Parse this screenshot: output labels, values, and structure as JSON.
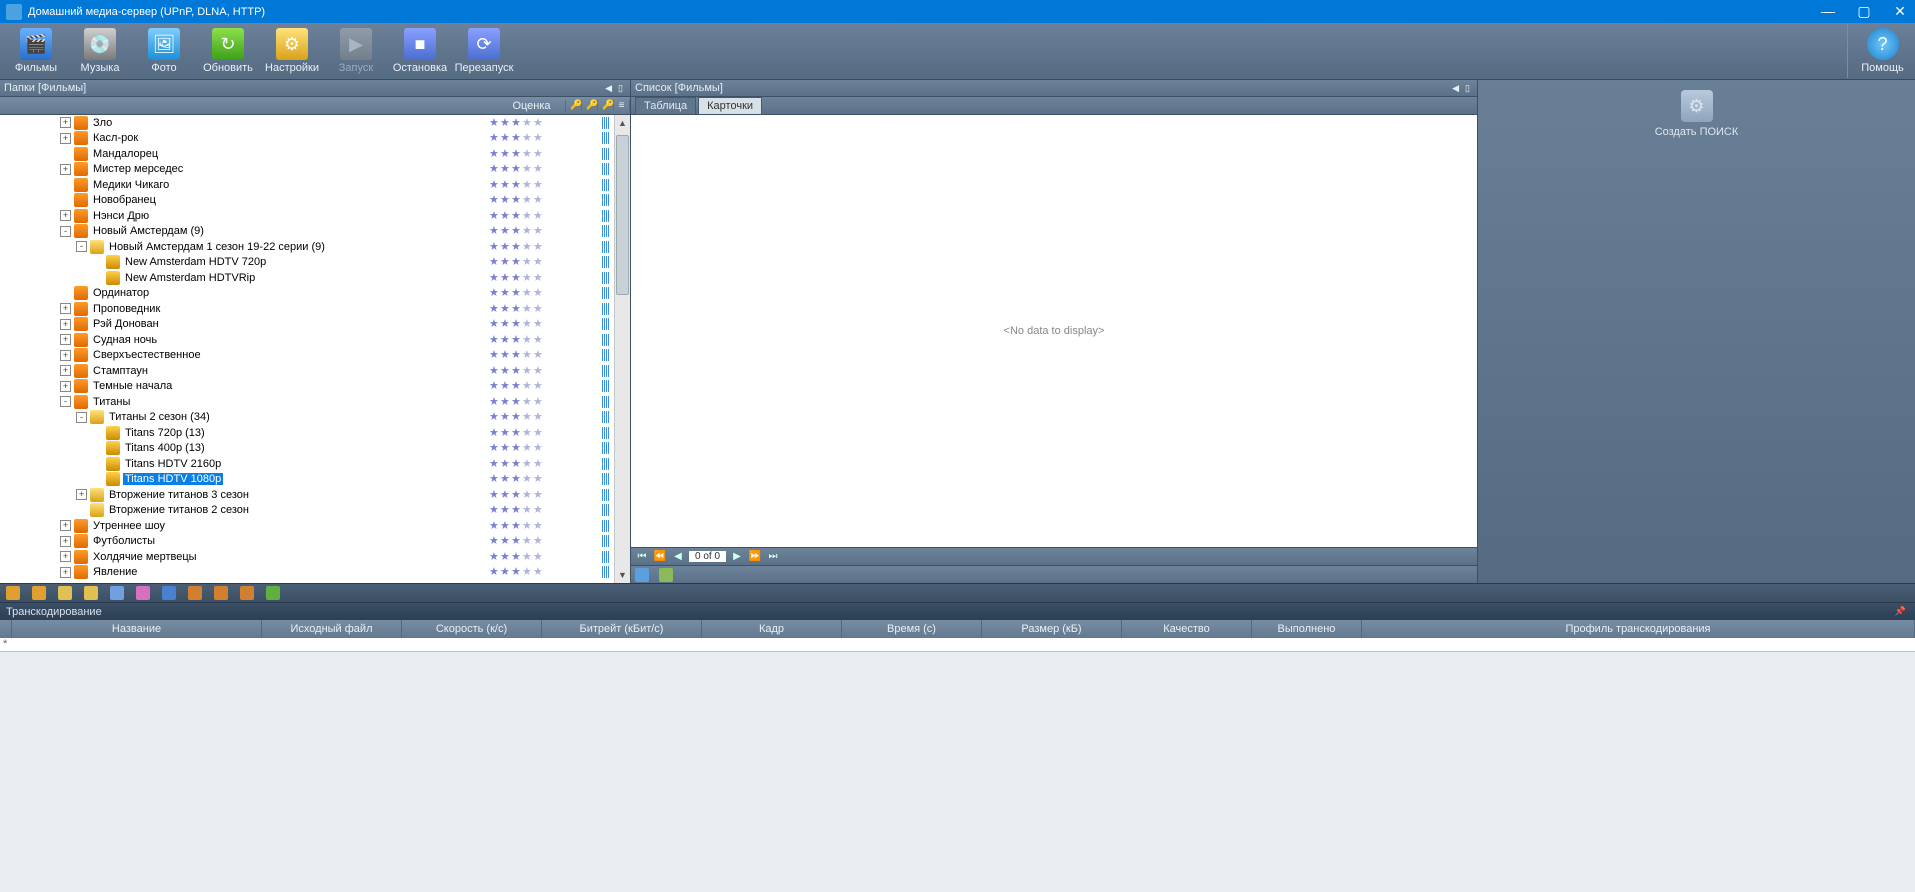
{
  "window": {
    "title": "Домашний медиа-сервер (UPnP, DLNA, HTTP)"
  },
  "toolbar": {
    "films": "Фильмы",
    "music": "Музыка",
    "photo": "Фото",
    "refresh": "Обновить",
    "settings": "Настройки",
    "start": "Запуск",
    "stop": "Остановка",
    "restart": "Перезапуск",
    "help": "Помощь"
  },
  "panels": {
    "folders_title": "Папки [Фильмы]",
    "list_title": "Список [Фильмы]",
    "rating_header": "Оценка"
  },
  "tabs": {
    "table": "Таблица",
    "cards": "Карточки"
  },
  "cards_area": {
    "no_data": "<No data to display>"
  },
  "navigator": {
    "position": "0 of 0"
  },
  "side": {
    "create": "Создать",
    "search": "ПОИСК"
  },
  "transcoding": {
    "title": "Транскодирование",
    "cols": {
      "name": "Название",
      "source": "Исходный файл",
      "speed": "Скорость (к/с)",
      "bitrate": "Битрейт (кБит/с)",
      "frame": "Кадр",
      "time": "Время (с)",
      "size": "Размер (кБ)",
      "quality": "Качество",
      "done": "Выполнено",
      "profile": "Профиль транскодирования"
    }
  },
  "tree": [
    {
      "indent": 2,
      "exp": "+",
      "icon": "rss",
      "label": "Зло",
      "rating": 3,
      "stripe": true
    },
    {
      "indent": 2,
      "exp": "+",
      "icon": "rss",
      "label": "Касл-рок",
      "rating": 3,
      "stripe": true
    },
    {
      "indent": 2,
      "exp": "",
      "icon": "rss",
      "label": "Мандалорец",
      "rating": 3,
      "stripe": true
    },
    {
      "indent": 2,
      "exp": "+",
      "icon": "rss",
      "label": "Мистер мерседес",
      "rating": 3,
      "stripe": true
    },
    {
      "indent": 2,
      "exp": "",
      "icon": "rss",
      "label": "Медики Чикаго",
      "rating": 3,
      "stripe": true
    },
    {
      "indent": 2,
      "exp": "",
      "icon": "rss",
      "label": "Новобранец",
      "rating": 3,
      "stripe": true
    },
    {
      "indent": 2,
      "exp": "+",
      "icon": "rss",
      "label": "Нэнси Дрю",
      "rating": 3,
      "stripe": true
    },
    {
      "indent": 2,
      "exp": "-",
      "icon": "rss",
      "label": "Новый Амстердам (9)",
      "rating": 3,
      "stripe": true
    },
    {
      "indent": 3,
      "exp": "-",
      "icon": "folder",
      "label": "Новый Амстердам 1 сезон 19-22 серии (9)",
      "rating": 3,
      "stripe": true
    },
    {
      "indent": 4,
      "exp": "",
      "icon": "item",
      "label": "New Amsterdam  HDTV 720p",
      "rating": 3,
      "stripe": true
    },
    {
      "indent": 4,
      "exp": "",
      "icon": "item",
      "label": "New Amsterdam  HDTVRip",
      "rating": 3,
      "stripe": true
    },
    {
      "indent": 2,
      "exp": "",
      "icon": "rss",
      "label": "Ординатор",
      "rating": 3,
      "stripe": true
    },
    {
      "indent": 2,
      "exp": "+",
      "icon": "rss",
      "label": "Проповедник",
      "rating": 3,
      "stripe": true
    },
    {
      "indent": 2,
      "exp": "+",
      "icon": "rss",
      "label": "Рэй Донован",
      "rating": 3,
      "stripe": true
    },
    {
      "indent": 2,
      "exp": "+",
      "icon": "rss",
      "label": "Судная ночь",
      "rating": 3,
      "stripe": true
    },
    {
      "indent": 2,
      "exp": "+",
      "icon": "rss",
      "label": "Сверхъестественное",
      "rating": 3,
      "stripe": true
    },
    {
      "indent": 2,
      "exp": "+",
      "icon": "rss",
      "label": "Стамптаун",
      "rating": 3,
      "stripe": true
    },
    {
      "indent": 2,
      "exp": "+",
      "icon": "rss",
      "label": "Темные начала",
      "rating": 3,
      "stripe": true
    },
    {
      "indent": 2,
      "exp": "-",
      "icon": "rss",
      "label": "Титаны",
      "rating": 3,
      "stripe": true
    },
    {
      "indent": 3,
      "exp": "-",
      "icon": "folder",
      "label": "Титаны 2 сезон (34)",
      "rating": 3,
      "stripe": true
    },
    {
      "indent": 4,
      "exp": "",
      "icon": "item",
      "label": "Titans  720p (13)",
      "rating": 3,
      "stripe": true
    },
    {
      "indent": 4,
      "exp": "",
      "icon": "item",
      "label": "Titans  400p (13)",
      "rating": 3,
      "stripe": true
    },
    {
      "indent": 4,
      "exp": "",
      "icon": "item",
      "label": "Titans  HDTV 2160p",
      "rating": 3,
      "stripe": true
    },
    {
      "indent": 4,
      "exp": "",
      "icon": "item",
      "label": "Titans  HDTV 1080p",
      "rating": 3,
      "stripe": true,
      "selected": true
    },
    {
      "indent": 3,
      "exp": "+",
      "icon": "folder",
      "label": "Вторжение титанов 3 сезон",
      "rating": 3,
      "stripe": true
    },
    {
      "indent": 3,
      "exp": "",
      "icon": "folder",
      "label": "Вторжение титанов 2 сезон",
      "rating": 3,
      "stripe": true
    },
    {
      "indent": 2,
      "exp": "+",
      "icon": "rss",
      "label": "Утреннее шоу",
      "rating": 3,
      "stripe": true
    },
    {
      "indent": 2,
      "exp": "+",
      "icon": "rss",
      "label": "Футболисты",
      "rating": 3,
      "stripe": true
    },
    {
      "indent": 2,
      "exp": "+",
      "icon": "rss",
      "label": "Холдячие мертвецы",
      "rating": 3,
      "stripe": true
    },
    {
      "indent": 2,
      "exp": "+",
      "icon": "rss",
      "label": "Явление",
      "rating": 3,
      "stripe": true
    }
  ]
}
